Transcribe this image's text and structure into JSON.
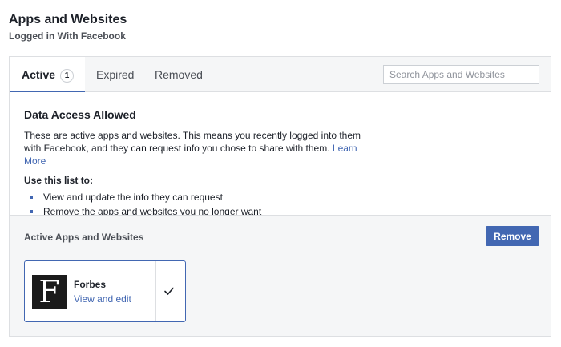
{
  "header": {
    "title": "Apps and Websites",
    "subtitle": "Logged in With Facebook"
  },
  "tabs": [
    {
      "label": "Active",
      "count": "1",
      "selected": true
    },
    {
      "label": "Expired",
      "selected": false
    },
    {
      "label": "Removed",
      "selected": false
    }
  ],
  "search": {
    "placeholder": "Search Apps and Websites",
    "value": ""
  },
  "info": {
    "heading": "Data Access Allowed",
    "text": "These are active apps and websites. This means you recently logged into them with Facebook, and they can request info you chose to share with them.",
    "learn_more": "Learn More",
    "use_list_label": "Use this list to:",
    "bullets": [
      "View and update the info they can request",
      "Remove the apps and websites you no longer want"
    ]
  },
  "apps_section": {
    "heading": "Active Apps and Websites",
    "remove_label": "Remove",
    "apps": [
      {
        "name": "Forbes",
        "link": "View and edit",
        "logo_letter": "F",
        "logo_icon": "forbes-logo-icon",
        "checked": true
      }
    ]
  },
  "colors": {
    "accent": "#4267b2",
    "border": "#dddfe2",
    "section_bg": "#f5f6f7",
    "text": "#1d2129"
  }
}
